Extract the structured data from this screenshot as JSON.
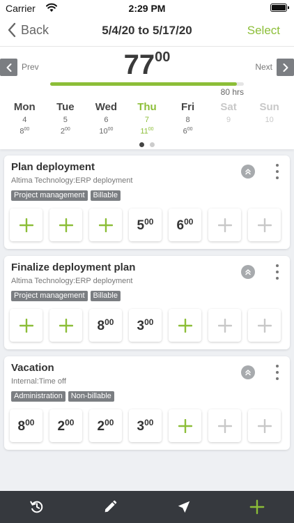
{
  "status_bar": {
    "carrier": "Carrier",
    "time": "2:29 PM"
  },
  "nav": {
    "back_label": "Back",
    "title": "5/4/20 to 5/17/20",
    "select_label": "Select"
  },
  "summary": {
    "prev_label": "Prev",
    "next_label": "Next",
    "total_whole": "77",
    "total_frac": "00",
    "capacity": "80 hrs",
    "progress_fraction": 0.9625,
    "days": [
      {
        "name": "Mon",
        "num": "4",
        "h": "8",
        "m": "00",
        "state": "normal"
      },
      {
        "name": "Tue",
        "num": "5",
        "h": "2",
        "m": "00",
        "state": "normal"
      },
      {
        "name": "Wed",
        "num": "6",
        "h": "10",
        "m": "00",
        "state": "normal"
      },
      {
        "name": "Thu",
        "num": "7",
        "h": "11",
        "m": "00",
        "state": "today"
      },
      {
        "name": "Fri",
        "num": "8",
        "h": "6",
        "m": "00",
        "state": "normal"
      },
      {
        "name": "Sat",
        "num": "9",
        "h": "",
        "m": "",
        "state": "weekend"
      },
      {
        "name": "Sun",
        "num": "10",
        "h": "",
        "m": "",
        "state": "weekend"
      }
    ],
    "page_count": 2,
    "active_page": 0
  },
  "cards": [
    {
      "name": "Plan deployment",
      "client": "Altima Technology:ERP deployment",
      "tags": [
        "Project management",
        "Billable"
      ],
      "cells": [
        {
          "type": "add-active"
        },
        {
          "type": "add-active"
        },
        {
          "type": "add-active"
        },
        {
          "type": "hours",
          "h": "5",
          "m": "00"
        },
        {
          "type": "hours",
          "h": "6",
          "m": "00"
        },
        {
          "type": "add-weekend"
        },
        {
          "type": "add-weekend"
        }
      ]
    },
    {
      "name": "Finalize deployment plan",
      "client": "Altima Technology:ERP deployment",
      "tags": [
        "Project management",
        "Billable"
      ],
      "cells": [
        {
          "type": "add-active"
        },
        {
          "type": "add-active"
        },
        {
          "type": "hours",
          "h": "8",
          "m": "00"
        },
        {
          "type": "hours",
          "h": "3",
          "m": "00"
        },
        {
          "type": "add-active"
        },
        {
          "type": "add-weekend"
        },
        {
          "type": "add-weekend"
        }
      ]
    },
    {
      "name": "Vacation",
      "client": "Internal:Time off",
      "tags": [
        "Administration",
        "Non-billable"
      ],
      "cells": [
        {
          "type": "hours",
          "h": "8",
          "m": "00"
        },
        {
          "type": "hours",
          "h": "2",
          "m": "00"
        },
        {
          "type": "hours",
          "h": "2",
          "m": "00"
        },
        {
          "type": "hours",
          "h": "3",
          "m": "00"
        },
        {
          "type": "add-active"
        },
        {
          "type": "add-weekend"
        },
        {
          "type": "add-weekend"
        }
      ]
    }
  ],
  "toolbar": {
    "items": [
      {
        "icon": "history-icon",
        "name": "history-button"
      },
      {
        "icon": "pencil-icon",
        "name": "edit-button"
      },
      {
        "icon": "send-icon",
        "name": "submit-button"
      },
      {
        "icon": "plus-icon",
        "name": "add-button"
      }
    ]
  },
  "colors": {
    "accent": "#8cbe38",
    "tag": "#7b7e82",
    "toolbar": "#36393e",
    "muted_plus": "#c8c8c8"
  }
}
